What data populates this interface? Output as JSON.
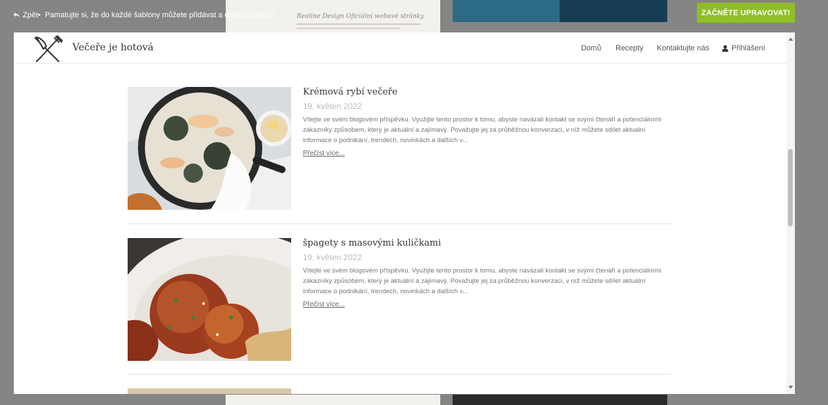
{
  "overlay": {
    "back_label": "Zpět",
    "hint": "Pamatujte si, že do každé šablony můžete přidávat a odebírat sekce.",
    "start_button": "ZAČNĚTE UPRAVOVAT!"
  },
  "background_preview": {
    "left_title": "Realine Design Oficiální webové stránky"
  },
  "site": {
    "name": "Večeře je hotová",
    "nav": {
      "home": "Domů",
      "recipes": "Recepty",
      "contact": "Kontaktujte nás",
      "login": "Přihlášení"
    }
  },
  "posts": [
    {
      "title": "Krémová rybí večeře",
      "date": "19. květen 2022",
      "excerpt": "Vítejte ve svém blogovém příspěvku. Využijte tento prostor k tomu, abyste navázali kontakt se svými čtenáři a potenciálními zákazníky způsobem, který je aktuální a zajímavý. Považujte jej za průběžnou konverzaci, v níž můžete sdílet aktuální informace o podnikání, trendech, novinkách a dalších v...",
      "more": "Přečíst více..."
    },
    {
      "title": "špagety s masovými kuličkami",
      "date": "19. květen 2022",
      "excerpt": "Vítejte ve svém blogovém příspěvku. Využijte tento prostor k tomu, abyste navázali kontakt se svými čtenáři a potenciálními zákazníky způsobem, který je aktuální a zajímavý. Považujte jej za průběžnou konverzaci, v níž můžete sdílet aktuální informace o podnikání, trendech, novinkách a dalších v...",
      "more": "Přečíst více..."
    }
  ],
  "colors": {
    "accent_button": "#8fbf27",
    "overlay_bg": "#858585"
  },
  "icons": [
    "back-arrow-icon",
    "fork-knife-logo-icon",
    "user-icon",
    "scroll-up-icon",
    "scroll-down-icon"
  ]
}
